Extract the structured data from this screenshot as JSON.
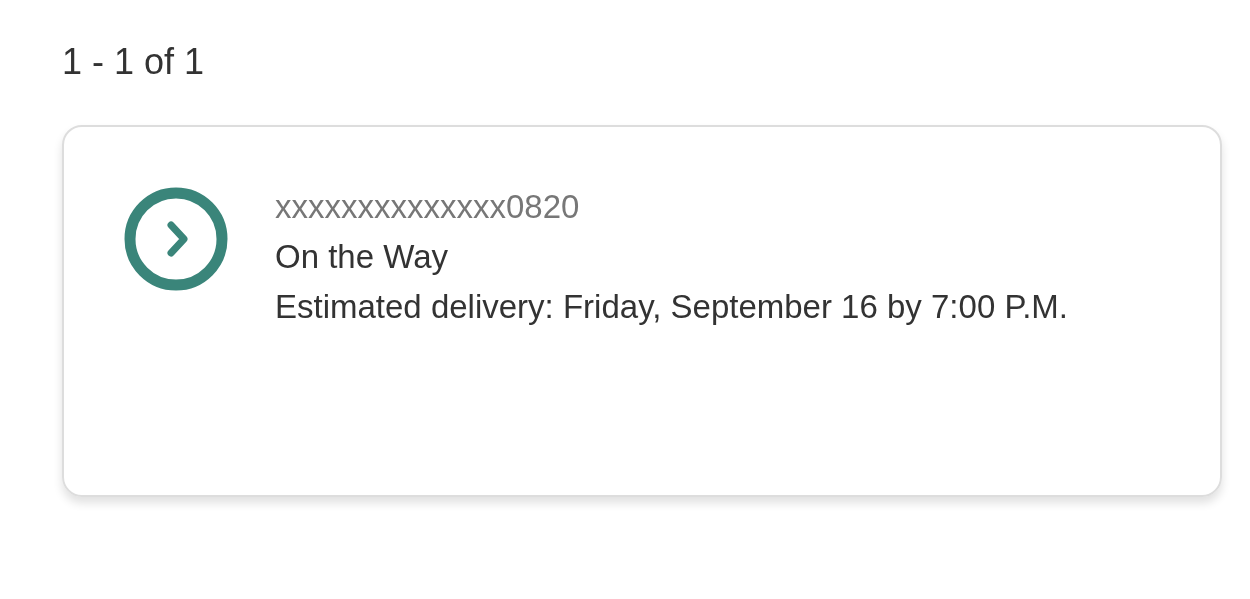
{
  "result_count": "1 - 1 of 1",
  "shipments": [
    {
      "tracking_number": "xxxxxxxxxxxxxx0820",
      "status": "On the Way",
      "estimate": "Estimated delivery: Friday, September 16 by 7:00 P.M."
    }
  ]
}
